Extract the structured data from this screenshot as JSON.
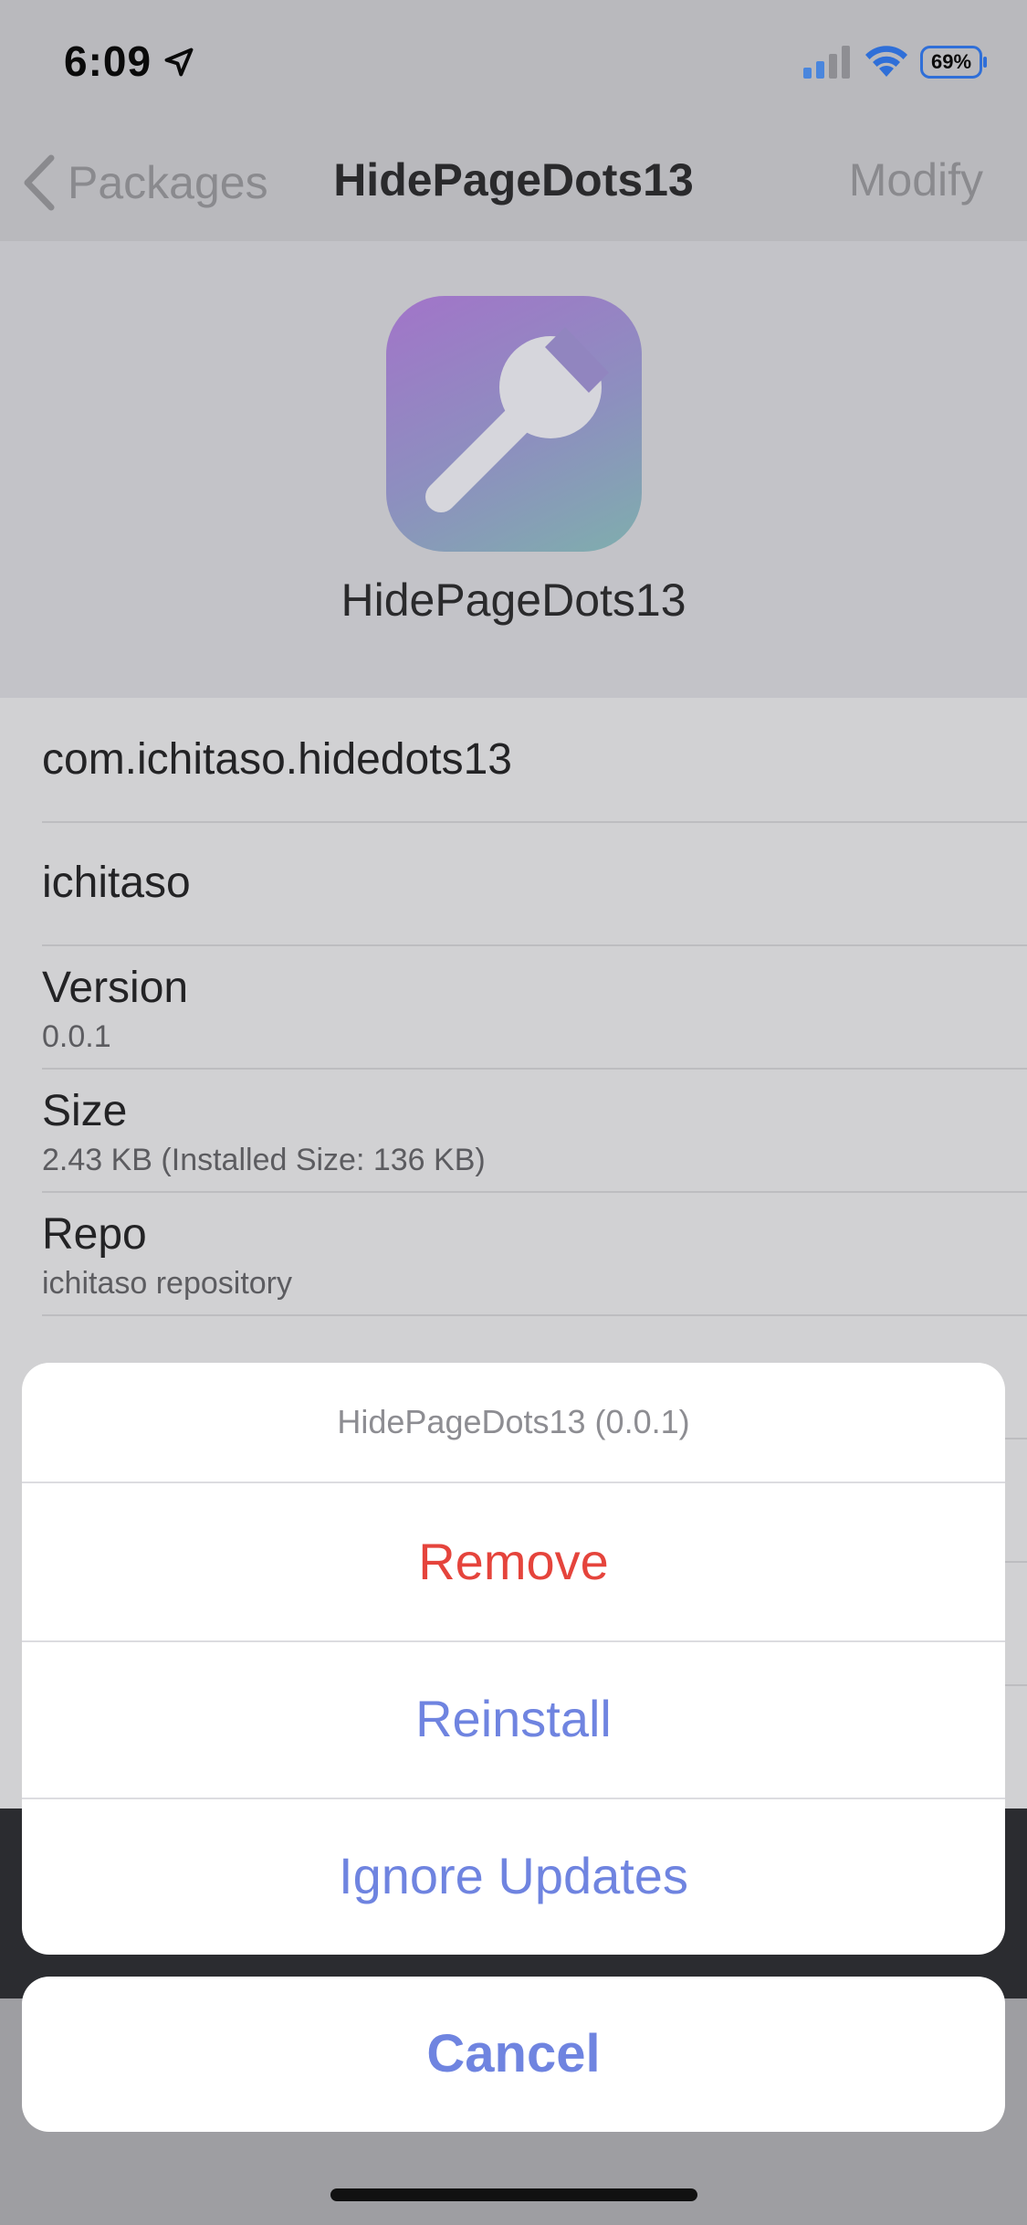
{
  "status_bar": {
    "time": "6:09",
    "battery": "69%",
    "icons": [
      "location-arrow-icon",
      "cellular-signal-icon",
      "wifi-icon",
      "battery-icon"
    ]
  },
  "nav": {
    "back_label": "Packages",
    "title": "HidePageDots13",
    "right_label": "Modify"
  },
  "package": {
    "name": "HidePageDots13",
    "icon": "wrench-icon",
    "icon_gradient": [
      "#a274c9",
      "#7faead"
    ]
  },
  "details": {
    "identifier": "com.ichitaso.hidedots13",
    "author": "ichitaso",
    "version_label": "Version",
    "version_value": "0.0.1",
    "size_label": "Size",
    "size_value": "2.43 KB (Installed Size: 136 KB)",
    "repo_label": "Repo",
    "repo_value": "ichitaso repository"
  },
  "action_sheet": {
    "title": "HidePageDots13 (0.0.1)",
    "remove": "Remove",
    "reinstall": "Reinstall",
    "ignore_updates": "Ignore Updates",
    "cancel": "Cancel"
  },
  "colors": {
    "destructive": "#e5443c",
    "accent": "#6f84e0"
  }
}
